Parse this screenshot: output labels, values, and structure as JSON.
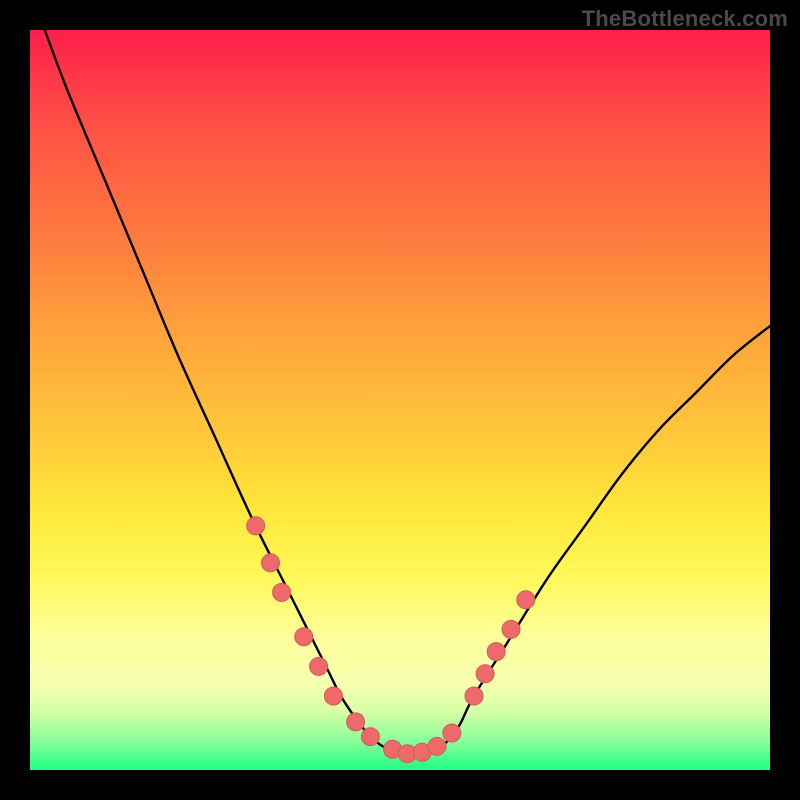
{
  "watermark": "TheBottleneck.com",
  "colors": {
    "curve_stroke": "#000000",
    "dot_fill": "#ee6a6a",
    "dot_stroke": "#d15a5a"
  },
  "chart_data": {
    "type": "line",
    "title": "",
    "xlabel": "",
    "ylabel": "",
    "xlim": [
      0,
      100
    ],
    "ylim": [
      0,
      100
    ],
    "grid": false,
    "series": [
      {
        "name": "bottleneck-curve",
        "x": [
          2,
          5,
          10,
          15,
          20,
          25,
          30,
          35,
          40,
          42,
          44,
          46,
          48,
          50,
          52,
          54,
          56,
          58,
          60,
          65,
          70,
          75,
          80,
          85,
          90,
          95,
          100
        ],
        "y": [
          100,
          92,
          80,
          68,
          56,
          45,
          34,
          24,
          14,
          10,
          7,
          4.5,
          3,
          2.2,
          2,
          2.4,
          3.5,
          6,
          10,
          18,
          26,
          33,
          40,
          46,
          51,
          56,
          60
        ]
      }
    ],
    "markers": [
      {
        "x": 30.5,
        "y": 33
      },
      {
        "x": 32.5,
        "y": 28
      },
      {
        "x": 34,
        "y": 24
      },
      {
        "x": 37,
        "y": 18
      },
      {
        "x": 39,
        "y": 14
      },
      {
        "x": 41,
        "y": 10
      },
      {
        "x": 44,
        "y": 6.5
      },
      {
        "x": 46,
        "y": 4.5
      },
      {
        "x": 49,
        "y": 2.8
      },
      {
        "x": 51,
        "y": 2.2
      },
      {
        "x": 53,
        "y": 2.4
      },
      {
        "x": 55,
        "y": 3.2
      },
      {
        "x": 57,
        "y": 5
      },
      {
        "x": 60,
        "y": 10
      },
      {
        "x": 61.5,
        "y": 13
      },
      {
        "x": 63,
        "y": 16
      },
      {
        "x": 65,
        "y": 19
      },
      {
        "x": 67,
        "y": 23
      }
    ]
  }
}
